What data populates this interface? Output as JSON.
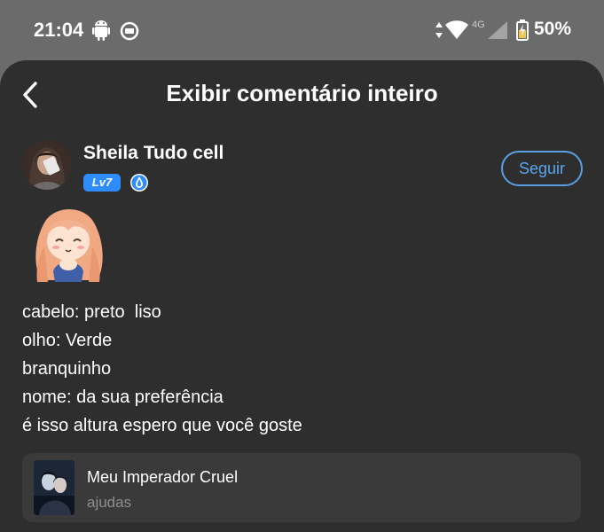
{
  "status_bar": {
    "time": "21:04",
    "network": "4G",
    "battery": "50%",
    "icons": [
      "android-icon",
      "media-icon",
      "data-arrows-icon",
      "wifi-icon",
      "signal-icon",
      "battery-icon"
    ]
  },
  "header": {
    "title": "Exibir comentário inteiro",
    "back_icon": "chevron-left-icon"
  },
  "user": {
    "name": "Sheila Tudo cell",
    "level": "Lv7",
    "verified_icon": "water-drop-badge-icon",
    "follow_label": "Seguir"
  },
  "comment": {
    "sticker": "anime-girl-sticker",
    "lines": [
      "cabelo: preto  liso",
      "olho: Verde",
      "branquinho",
      "nome: da sua preferência",
      "é isso altura espero que você goste"
    ]
  },
  "story": {
    "title": "Meu Imperador Cruel",
    "subtitle": "ajudas"
  },
  "colors": {
    "background": "#2e2e2e",
    "status_bar": "#6b6b6b",
    "accent": "#2f8cff",
    "card": "#3a3a3a"
  }
}
